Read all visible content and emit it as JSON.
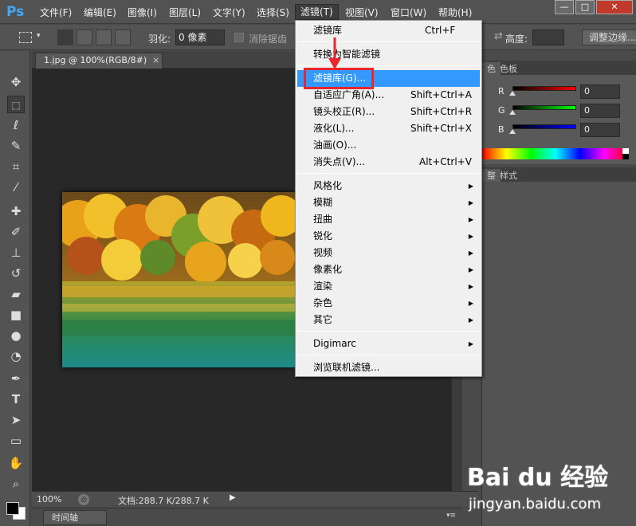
{
  "app": {
    "logo": "Ps"
  },
  "menubar": {
    "items": [
      "文件(F)",
      "编辑(E)",
      "图像(I)",
      "图层(L)",
      "文字(Y)",
      "选择(S)",
      "滤镜(T)",
      "视图(V)",
      "窗口(W)",
      "帮助(H)"
    ],
    "active": "滤镜(T)"
  },
  "window_controls": {
    "minimize": "—",
    "restore": "□",
    "close": "✕"
  },
  "options": {
    "feather_label": "羽化:",
    "feather_value": "0 像素",
    "antialias_label": "消除锯齿",
    "height_label": "高度:",
    "adjust_edge_label": "调整边缘..."
  },
  "document": {
    "tab_title": "1.jpg @ 100%(RGB/8#)",
    "tab_close": "×"
  },
  "status": {
    "zoom": "100%",
    "doc_info": "文档:288.7 K/288.7 K"
  },
  "timeline": {
    "tab_label": "时间轴"
  },
  "panels": {
    "color_tabs": [
      "色",
      "色板"
    ],
    "rgb": [
      {
        "label": "R",
        "value": "0"
      },
      {
        "label": "G",
        "value": "0"
      },
      {
        "label": "B",
        "value": "0"
      }
    ],
    "lower_tabs": [
      "整",
      "样式"
    ]
  },
  "filter_menu": {
    "items": [
      {
        "label": "滤镜库",
        "shortcut": "Ctrl+F"
      },
      {
        "label": "转换为智能滤镜",
        "shortcut": ""
      },
      {
        "label": "滤镜库(G)...",
        "shortcut": ""
      },
      {
        "label": "自适应广角(A)...",
        "shortcut": "Shift+Ctrl+A"
      },
      {
        "label": "镜头校正(R)...",
        "shortcut": "Shift+Ctrl+R"
      },
      {
        "label": "液化(L)...",
        "shortcut": "Shift+Ctrl+X"
      },
      {
        "label": "油画(O)...",
        "shortcut": ""
      },
      {
        "label": "消失点(V)...",
        "shortcut": "Alt+Ctrl+V"
      },
      {
        "label": "风格化",
        "shortcut": ""
      },
      {
        "label": "模糊",
        "shortcut": ""
      },
      {
        "label": "扭曲",
        "shortcut": ""
      },
      {
        "label": "锐化",
        "shortcut": ""
      },
      {
        "label": "视频",
        "shortcut": ""
      },
      {
        "label": "像素化",
        "shortcut": ""
      },
      {
        "label": "渲染",
        "shortcut": ""
      },
      {
        "label": "杂色",
        "shortcut": ""
      },
      {
        "label": "其它",
        "shortcut": ""
      },
      {
        "label": "Digimarc",
        "shortcut": ""
      },
      {
        "label": "浏览联机滤镜...",
        "shortcut": ""
      }
    ],
    "highlighted": "滤镜库(G)...",
    "submenu_arrow": "▶"
  },
  "colors": {
    "accent": "#3399ff",
    "annotation": "#e8262b",
    "ps_blue": "#3fa9f5"
  },
  "watermark": {
    "logo": "Bai du 经验",
    "url": "jingyan.baidu.com"
  },
  "toolbar_icons": [
    "move-icon",
    "marquee-icon",
    "lasso-icon",
    "quick-select-icon",
    "crop-icon",
    "eyedropper-icon",
    "healing-icon",
    "brush-icon",
    "stamp-icon",
    "history-brush-icon",
    "eraser-icon",
    "gradient-icon",
    "blur-icon",
    "dodge-icon",
    "pen-icon",
    "type-icon",
    "path-select-icon",
    "shape-icon",
    "hand-icon",
    "zoom-icon"
  ]
}
